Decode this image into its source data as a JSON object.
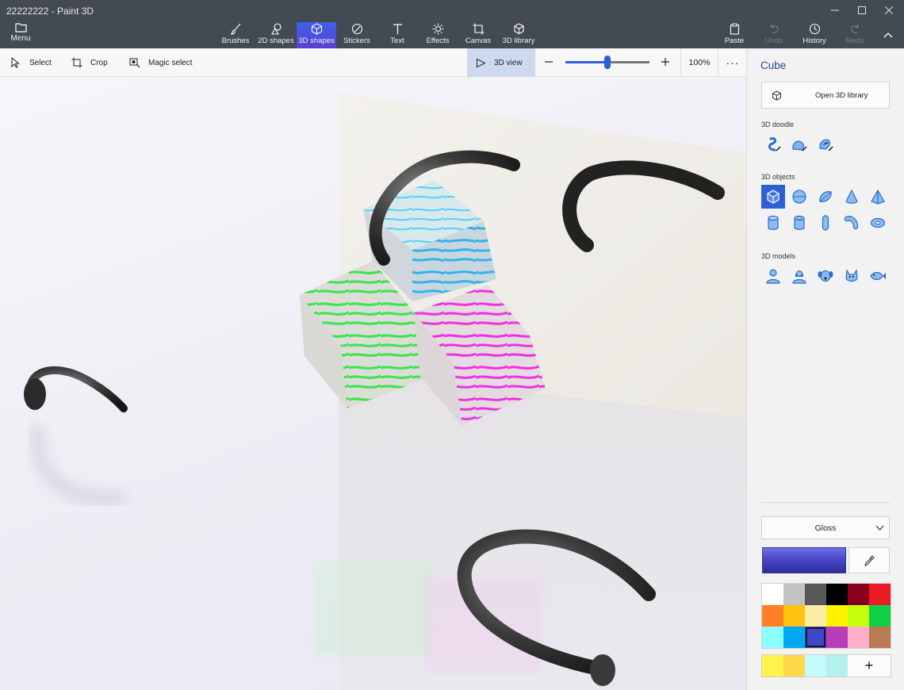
{
  "window": {
    "title": "22222222 - Paint 3D"
  },
  "menu": {
    "label": "Menu"
  },
  "ribbon": {
    "tools": [
      {
        "label": "Brushes",
        "icon": "brush-icon"
      },
      {
        "label": "2D shapes",
        "icon": "2d-shapes-icon"
      },
      {
        "label": "3D shapes",
        "icon": "3d-shapes-icon",
        "active": true
      },
      {
        "label": "Stickers",
        "icon": "stickers-icon"
      },
      {
        "label": "Text",
        "icon": "text-icon"
      },
      {
        "label": "Effects",
        "icon": "effects-icon"
      },
      {
        "label": "Canvas",
        "icon": "canvas-icon"
      },
      {
        "label": "3D library",
        "icon": "3d-library-icon"
      }
    ],
    "actions": [
      {
        "label": "Paste",
        "icon": "paste-icon",
        "enabled": true
      },
      {
        "label": "Undo",
        "icon": "undo-icon",
        "enabled": false
      },
      {
        "label": "History",
        "icon": "history-icon",
        "enabled": true
      },
      {
        "label": "Redo",
        "icon": "redo-icon",
        "enabled": false
      }
    ]
  },
  "toolbar": {
    "select_label": "Select",
    "crop_label": "Crop",
    "magic_select_label": "Magic select",
    "view_label": "3D view",
    "zoom_text": "100%",
    "zoom_slider_fraction": 0.5,
    "more_label": "···"
  },
  "panel": {
    "title": "Cube",
    "open_library_label": "Open 3D library",
    "doodle_label": "3D doodle",
    "doodle_icons": [
      "sharp-doodle-icon",
      "soft-doodle-icon",
      "tube-doodle-icon"
    ],
    "objects_label": "3D objects",
    "object_icons": [
      "cube-icon",
      "sphere-icon",
      "hemisphere-icon",
      "cone-icon",
      "pyramid-icon",
      "cylinder-icon",
      "tube-icon",
      "capsule-icon",
      "curved-tube-icon",
      "donut-icon"
    ],
    "selected_object": "cube-icon",
    "models_label": "3D models",
    "model_icons": [
      "man-icon",
      "woman-icon",
      "dog-icon",
      "cat-icon",
      "fish-icon"
    ],
    "material_label": "Gloss",
    "current_color": "#4646c6",
    "palette": [
      "#ffffff",
      "#c3c3c3",
      "#585858",
      "#000000",
      "#88001b",
      "#ec1c24",
      "#ff7f27",
      "#ffc20e",
      "#fdeca6",
      "#fff200",
      "#c4ff0e",
      "#0ed145",
      "#8cfffb",
      "#00a8f3",
      "#3f48cc",
      "#b83dba",
      "#ffaec8",
      "#b97a56"
    ],
    "selected_swatch": 14,
    "custom_colors": [
      "#fff24c",
      "#ffd84c",
      "#c4fafa",
      "#b4f0ec"
    ],
    "add_color_label": "+"
  }
}
